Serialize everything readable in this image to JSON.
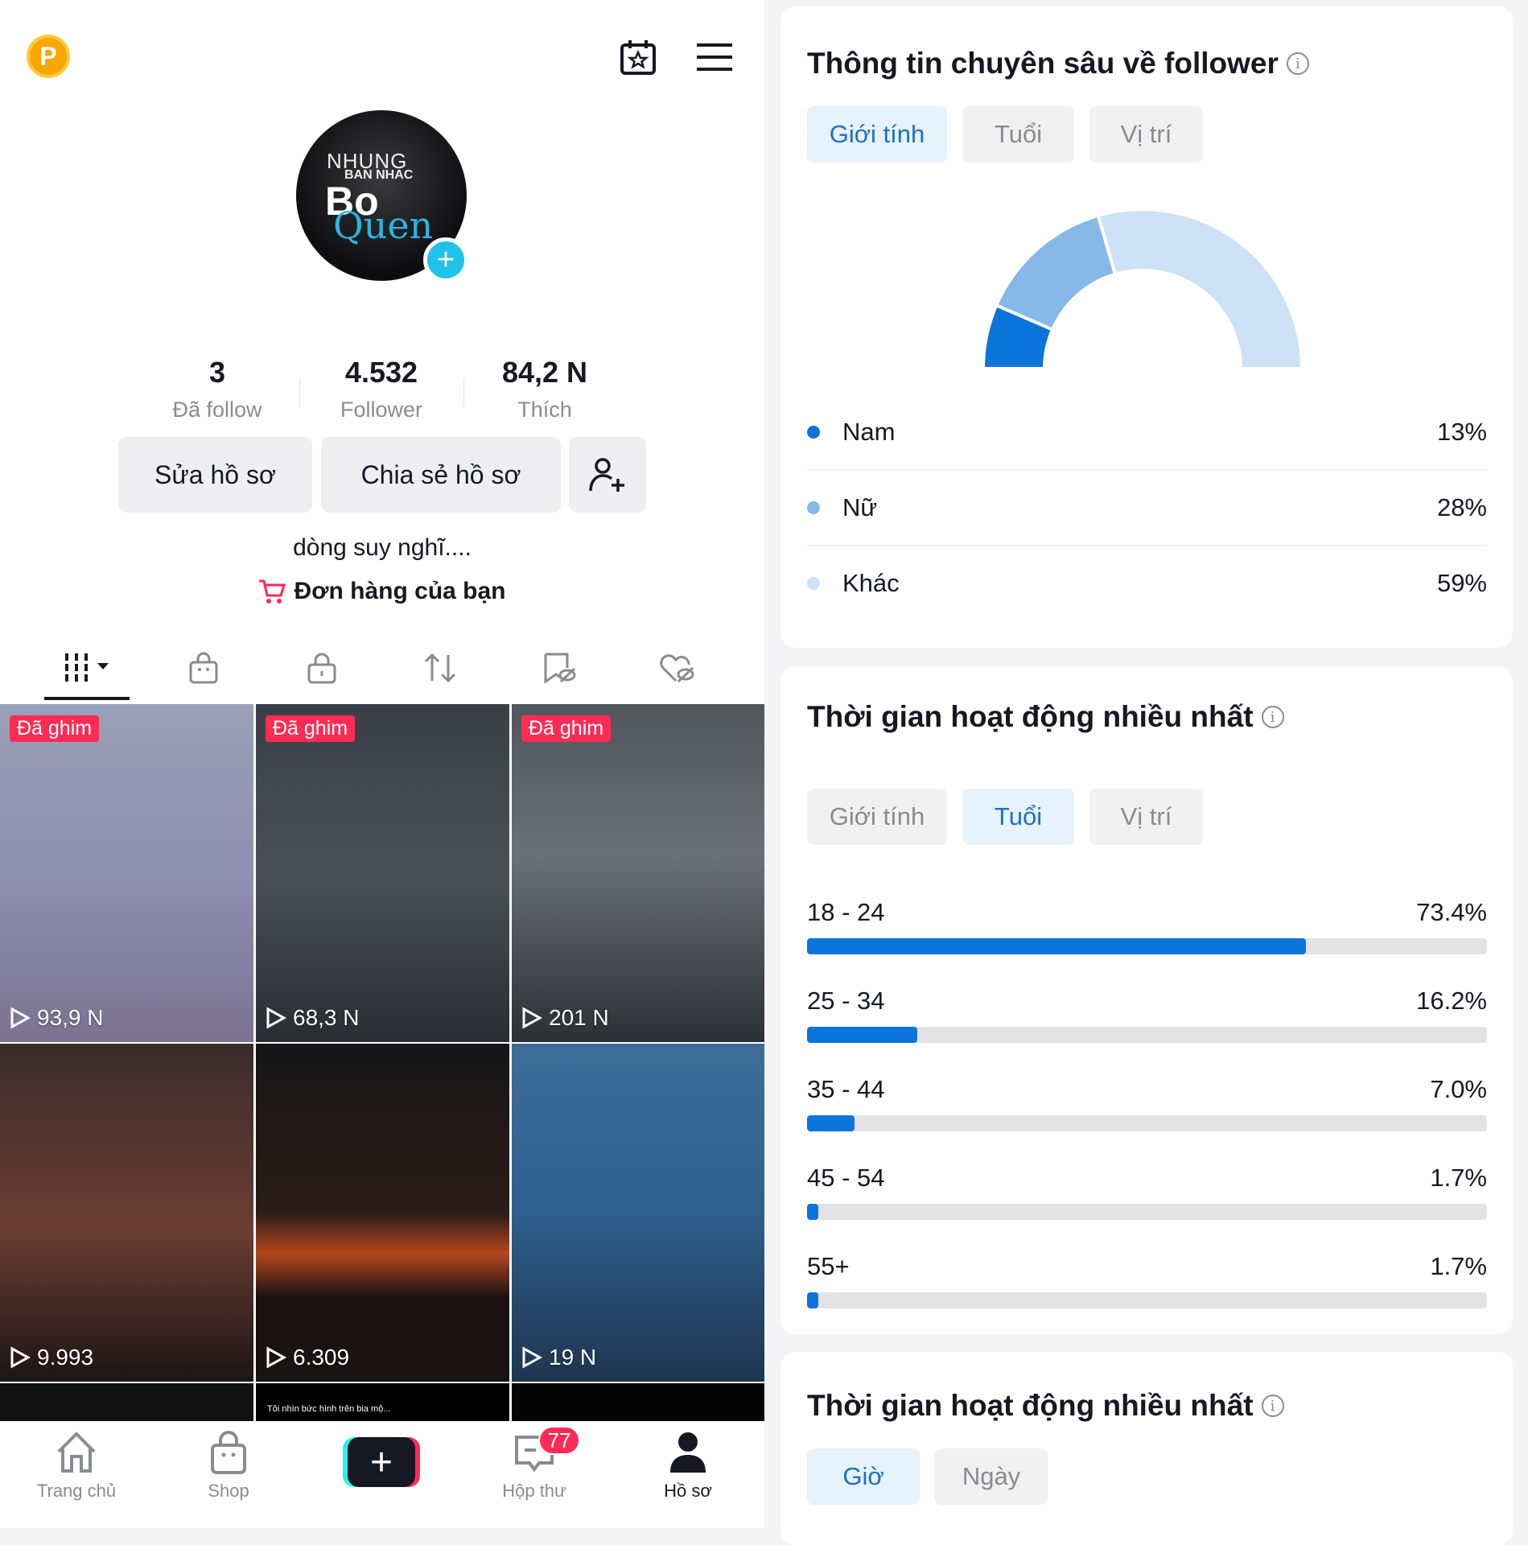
{
  "profile": {
    "coin_label": "P",
    "stats": [
      {
        "value": "3",
        "label": "Đã follow"
      },
      {
        "value": "4.532",
        "label": "Follower"
      },
      {
        "value": "84,2 N",
        "label": "Thích"
      }
    ],
    "avatar_text": [
      "NHUNG",
      "BAN NHAC",
      "Bo",
      "Quen"
    ],
    "edit_button": "Sửa hồ sơ",
    "share_button": "Chia sẻ hồ sơ",
    "bio": "dòng suy nghĩ....",
    "orders_link": "Đơn hàng của bạn"
  },
  "profile_tabs": [
    "videos-grid",
    "shop",
    "private",
    "reposts",
    "favorites-hidden",
    "liked-hidden"
  ],
  "videos": [
    {
      "pinned": "Đã ghim",
      "views": "93,9 N"
    },
    {
      "pinned": "Đã ghim",
      "views": "68,3 N"
    },
    {
      "pinned": "Đã ghim",
      "views": "201 N"
    },
    {
      "pinned": "",
      "views": "9.993"
    },
    {
      "pinned": "",
      "views": "6.309"
    },
    {
      "pinned": "",
      "views": "19 N"
    },
    {
      "caption": ""
    },
    {
      "caption": "Tôi nhìn bức hình trên bia mộ..."
    },
    {
      "caption": ""
    }
  ],
  "bottom_nav": [
    {
      "label": "Trang chủ",
      "icon": "home-icon"
    },
    {
      "label": "Shop",
      "icon": "shop-bag-icon"
    },
    {
      "label": "",
      "icon": "create-plus-icon"
    },
    {
      "label": "Hộp thư",
      "icon": "inbox-icon",
      "badge": "77"
    },
    {
      "label": "Hồ sơ",
      "icon": "profile-icon",
      "active": true
    }
  ],
  "follower_insights": {
    "title": "Thông tin chuyên sâu về follower",
    "tabs": [
      "Giới tính",
      "Tuổi",
      "Vị trí"
    ],
    "active_tab": "Giới tính"
  },
  "chart_data": [
    {
      "type": "pie",
      "variant": "semi-donut",
      "categories": [
        "Nam",
        "Nữ",
        "Khác"
      ],
      "values": [
        13,
        28,
        59
      ],
      "labels": [
        "13%",
        "28%",
        "59%"
      ],
      "colors": [
        "#0a74da",
        "#86b8e8",
        "#cde2f6"
      ]
    },
    {
      "type": "bar",
      "orientation": "horizontal",
      "categories": [
        "18 - 24",
        "25 - 34",
        "35 - 44",
        "45 - 54",
        "55+"
      ],
      "values": [
        73.4,
        16.2,
        7.0,
        1.7,
        1.7
      ],
      "labels": [
        "73.4%",
        "16.2%",
        "7.0%",
        "1.7%",
        "1.7%"
      ],
      "xlim": [
        0,
        100
      ],
      "color": "#0b75db"
    }
  ],
  "activity_age": {
    "title": "Thời gian hoạt động nhiều nhất",
    "tabs": [
      "Giới tính",
      "Tuổi",
      "Vị trí"
    ],
    "active_tab": "Tuổi"
  },
  "activity_time": {
    "title": "Thời gian hoạt động nhiều nhất",
    "tabs": [
      "Giờ",
      "Ngày"
    ],
    "active_tab": "Giờ"
  },
  "colors": {
    "accent": "#0b75db",
    "tab_active_bg": "#e6f2fc",
    "pin_red": "#fe2c55",
    "badge_red": "#fe2c55",
    "cyan": "#20c3e8"
  }
}
